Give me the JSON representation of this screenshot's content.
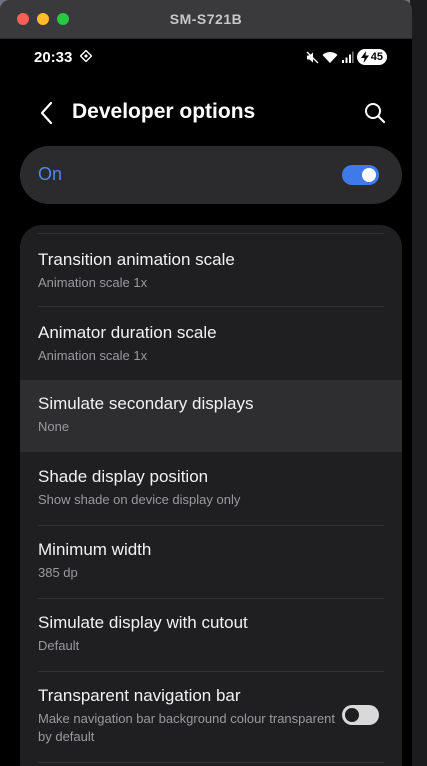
{
  "window": {
    "title": "SM-S721B"
  },
  "status_bar": {
    "time": "20:33",
    "battery": "45"
  },
  "app_bar": {
    "title": "Developer options"
  },
  "master_switch": {
    "label": "On",
    "state": "on"
  },
  "settings": [
    {
      "title": "Transition animation scale",
      "subtitle": "Animation scale 1x"
    },
    {
      "title": "Animator duration scale",
      "subtitle": "Animation scale 1x"
    },
    {
      "title": "Simulate secondary displays",
      "subtitle": "None",
      "highlighted": true
    },
    {
      "title": "Shade display position",
      "subtitle": "Show shade on device display only"
    },
    {
      "title": "Minimum width",
      "subtitle": "385 dp"
    },
    {
      "title": "Simulate display with cutout",
      "subtitle": "Default"
    },
    {
      "title": "Transparent navigation bar",
      "subtitle": "Make navigation bar background colour transparent by default",
      "toggle": "off"
    }
  ],
  "colors": {
    "accent": "#3e7be8",
    "on_label": "#4f86f7",
    "background": "#000000",
    "card": "#1f1f21"
  }
}
